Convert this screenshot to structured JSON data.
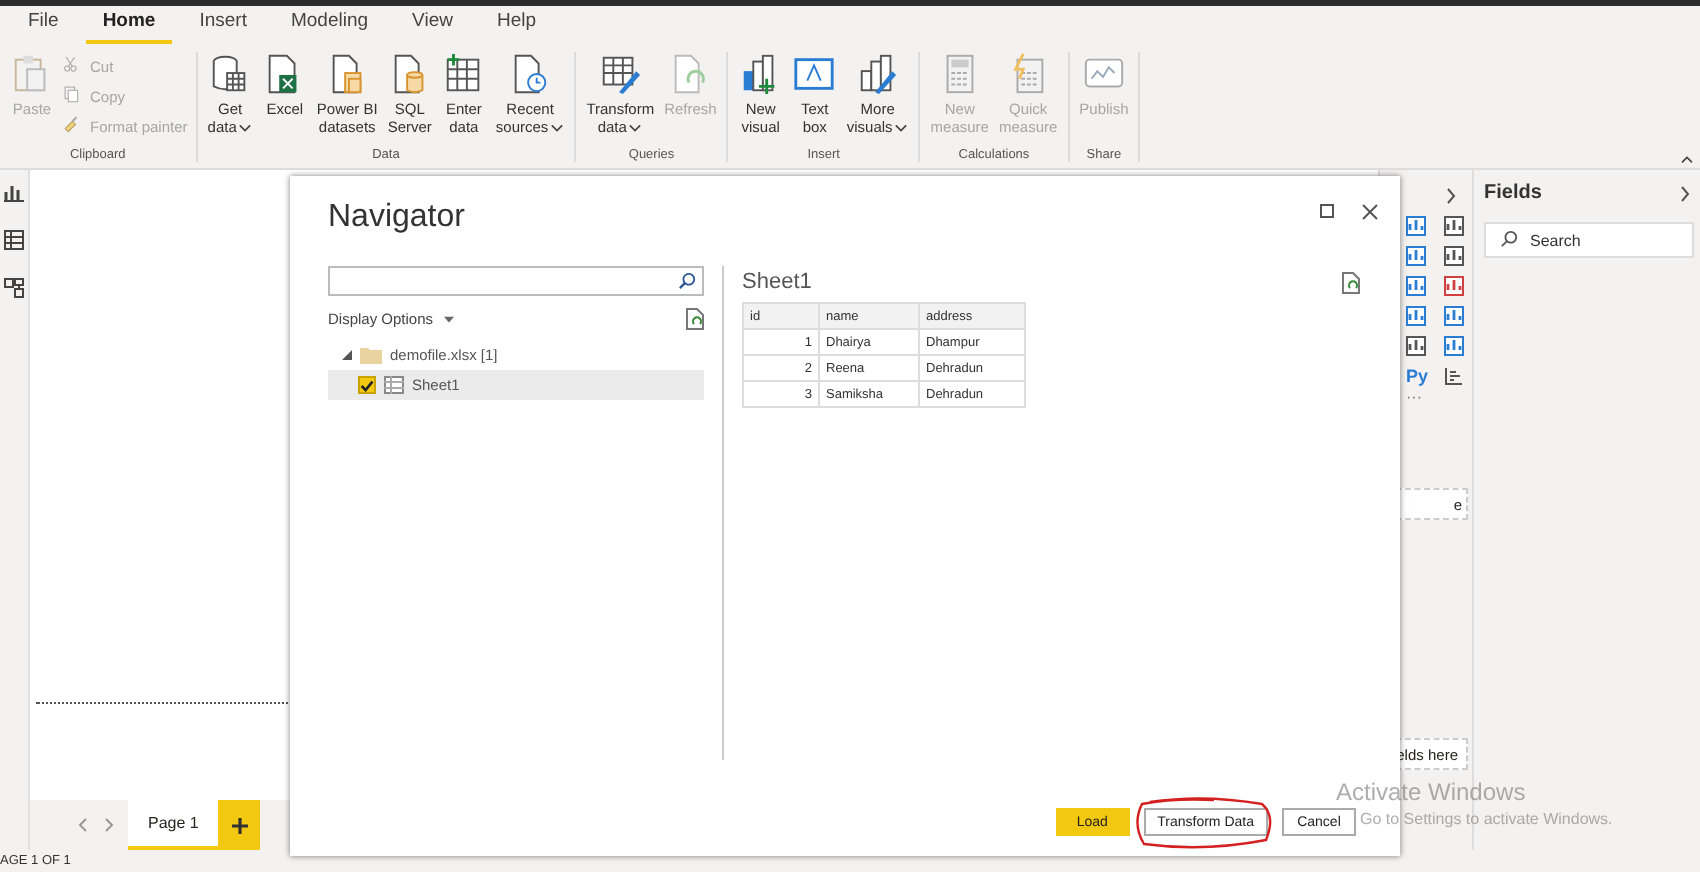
{
  "menu": [
    {
      "label": "File",
      "selected": false
    },
    {
      "label": "Home",
      "selected": true
    },
    {
      "label": "Insert",
      "selected": false
    },
    {
      "label": "Modeling",
      "selected": false
    },
    {
      "label": "View",
      "selected": false
    },
    {
      "label": "Help",
      "selected": false
    }
  ],
  "ribbon": [
    {
      "label": "Clipboard",
      "buttons": [
        {
          "kind": "large",
          "lines": [
            "Paste"
          ],
          "disabled": true,
          "dropdown": false
        },
        {
          "kind": "small",
          "lines": [
            "Cut"
          ],
          "disabled": true,
          "dropdown": false
        },
        {
          "kind": "small",
          "lines": [
            "Copy"
          ],
          "disabled": true,
          "dropdown": false
        },
        {
          "kind": "small",
          "lines": [
            "Format painter"
          ],
          "disabled": true,
          "dropdown": false
        }
      ]
    },
    {
      "label": "Data",
      "buttons": [
        {
          "kind": "large",
          "lines": [
            "Get",
            "data"
          ],
          "dropdown": true,
          "disabled": false
        },
        {
          "kind": "large",
          "lines": [
            "Excel"
          ],
          "disabled": false,
          "dropdown": false
        },
        {
          "kind": "large",
          "lines": [
            "Power BI",
            "datasets"
          ],
          "disabled": false,
          "dropdown": false
        },
        {
          "kind": "large",
          "lines": [
            "SQL",
            "Server"
          ],
          "disabled": false,
          "dropdown": false
        },
        {
          "kind": "large",
          "lines": [
            "Enter",
            "data"
          ],
          "disabled": false,
          "dropdown": false
        },
        {
          "kind": "large",
          "lines": [
            "Recent",
            "sources"
          ],
          "dropdown": true,
          "disabled": false
        }
      ]
    },
    {
      "label": "Queries",
      "buttons": [
        {
          "kind": "large",
          "lines": [
            "Transform",
            "data"
          ],
          "dropdown": true,
          "disabled": false
        },
        {
          "kind": "large",
          "lines": [
            "Refresh"
          ],
          "disabled": true,
          "dropdown": false
        }
      ]
    },
    {
      "label": "Insert",
      "buttons": [
        {
          "kind": "large",
          "lines": [
            "New",
            "visual"
          ],
          "disabled": false,
          "dropdown": false
        },
        {
          "kind": "large",
          "lines": [
            "Text",
            "box"
          ],
          "disabled": false,
          "dropdown": false
        },
        {
          "kind": "large",
          "lines": [
            "More",
            "visuals"
          ],
          "dropdown": true,
          "disabled": false
        }
      ]
    },
    {
      "label": "Calculations",
      "buttons": [
        {
          "kind": "large",
          "lines": [
            "New",
            "measure"
          ],
          "disabled": true,
          "dropdown": false
        },
        {
          "kind": "large",
          "lines": [
            "Quick",
            "measure"
          ],
          "disabled": true,
          "dropdown": false
        }
      ]
    },
    {
      "label": "Share",
      "buttons": [
        {
          "kind": "large",
          "lines": [
            "Publish"
          ],
          "disabled": true,
          "dropdown": false
        }
      ]
    }
  ],
  "pages": [
    {
      "label": "Page 1",
      "selected": true
    }
  ],
  "status_bar": "AGE 1 OF 1",
  "visualizations": {
    "python_label": "Py",
    "more": "···",
    "drop_zones": [
      "e",
      "elds here"
    ]
  },
  "fields": {
    "title": "Fields",
    "search": {
      "placeholder": "Search"
    }
  },
  "navigator": {
    "title": "Navigator",
    "display_options": "Display Options",
    "tree": [
      {
        "label": "demofile.xlsx [1]",
        "expanded": true,
        "children": [
          {
            "label": "Sheet1",
            "checked": true,
            "selected": true
          }
        ]
      }
    ],
    "preview": {
      "title": "Sheet1",
      "columns": [
        "id",
        "name",
        "address"
      ],
      "rows": [
        [
          "1",
          "Dhairya",
          "Dhampur"
        ],
        [
          "2",
          "Reena",
          "Dehradun"
        ],
        [
          "3",
          "Samiksha",
          "Dehradun"
        ]
      ]
    },
    "buttons": [
      {
        "label": "Load",
        "kind": "primary"
      },
      {
        "label": "Transform Data",
        "kind": "default",
        "circled": true
      },
      {
        "label": "Cancel",
        "kind": "default"
      }
    ]
  },
  "os_notice": {
    "title": "Activate Windows",
    "subtitle": "Go to Settings to activate Windows."
  }
}
